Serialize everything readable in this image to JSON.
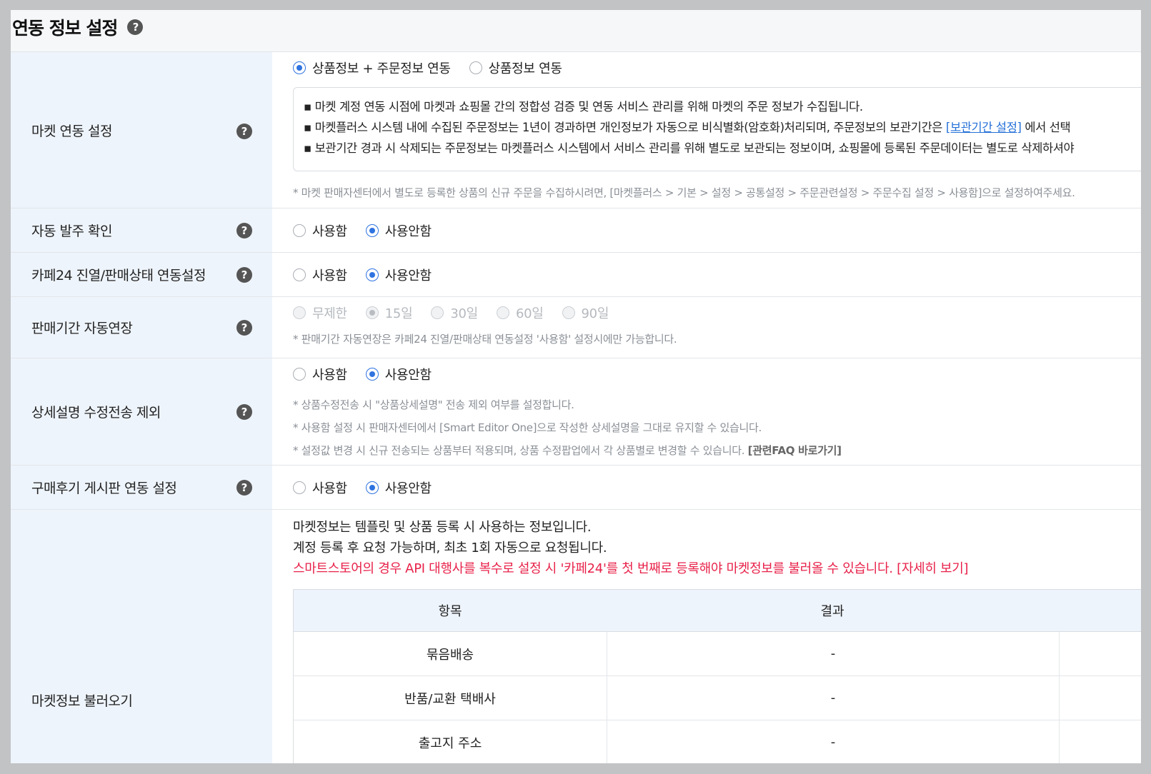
{
  "page": {
    "title": "연동 정보 설정",
    "help_glyph": "?"
  },
  "rows": [
    {
      "label": "마켓 연동 설정",
      "options": [
        {
          "label": "상품정보 + 주문정보 연동",
          "checked": true
        },
        {
          "label": "상품정보 연동",
          "checked": false
        }
      ],
      "notice": {
        "line1": "마켓 계정 연동 시점에 마켓과 쇼핑몰 간의 정합성 검증 및 연동 서비스 관리를 위해 마켓의 주문 정보가 수집됩니다.",
        "line2_pre": "마켓플러스 시스템 내에 수집된 주문정보는 1년이 경과하면 개인정보가 자동으로 비식별화(암호화)처리되며, 주문정보의 보관기간은 ",
        "line2_link": "[보관기간 설정]",
        "line2_post": " 에서 선택",
        "line3": "보관기간 경과 시 삭제되는 주문정보는 마켓플러스 시스템에서 서비스 관리를 위해 별도로 보관되는 정보이며, 쇼핑몰에 등록된 주문데이터는 별도로 삭제하셔야"
      },
      "note": "* 마켓 판매자센터에서 별도로 등록한 상품의 신규 주문을 수집하시려면, [마켓플러스 > 기본 > 설정 > 공통설정 > 주문관련설정 > 주문수집 설정 > 사용함]으로 설정하여주세요."
    },
    {
      "label": "자동 발주 확인",
      "options": [
        {
          "label": "사용함",
          "checked": false
        },
        {
          "label": "사용안함",
          "checked": true
        }
      ]
    },
    {
      "label": "카페24 진열/판매상태 연동설정",
      "options": [
        {
          "label": "사용함",
          "checked": false
        },
        {
          "label": "사용안함",
          "checked": true
        }
      ]
    },
    {
      "label": "판매기간 자동연장",
      "options": [
        {
          "label": "무제한",
          "checked": false
        },
        {
          "label": "15일",
          "checked": true
        },
        {
          "label": "30일",
          "checked": false
        },
        {
          "label": "60일",
          "checked": false
        },
        {
          "label": "90일",
          "checked": false
        }
      ],
      "note": "* 판매기간 자동연장은 카페24 진열/판매상태 연동설정 '사용함' 설정시에만 가능합니다."
    },
    {
      "label": "상세설명 수정전송 제외",
      "options": [
        {
          "label": "사용함",
          "checked": false
        },
        {
          "label": "사용안함",
          "checked": true
        }
      ],
      "notes": [
        "* 상품수정전송 시 \"상품상세설명\" 전송 제외 여부를 설정합니다.",
        "* 사용함 설정 시 판매자센터에서 [Smart Editor One]으로 작성한 상세설명을 그대로 유지할 수 있습니다.",
        "* 설정값 변경 시 신규 전송되는 상품부터 적용되며, 상품 수정팝업에서 각 상품별로 변경할 수 있습니다. "
      ],
      "faq_link": "[관련FAQ 바로가기]"
    },
    {
      "label": "구매후기 게시판 연동 설정",
      "options": [
        {
          "label": "사용함",
          "checked": false
        },
        {
          "label": "사용안함",
          "checked": true
        }
      ]
    },
    {
      "label": "마켓정보 불러오기",
      "info1": "마켓정보는 템플릿 및 상품 등록 시 사용하는 정보입니다.",
      "info2": "계정 등록 후 요청 가능하며, 최초 1회 자동으로 요청됩니다.",
      "info3": "스마트스토어의 경우 API 대행사를 복수로 설정 시 '카페24'를 첫 번째로 등록해야 마켓정보를 불러올 수 있습니다. [자세히 보기]",
      "table": {
        "headers": [
          "항목",
          "결과"
        ],
        "rows": [
          {
            "item": "묶음배송",
            "result": "-"
          },
          {
            "item": "반품/교환 택배사",
            "result": "-"
          },
          {
            "item": "출고지 주소",
            "result": "-"
          }
        ]
      }
    }
  ],
  "colors": {
    "accent": "#2f73e0",
    "label_bg": "#eef4fb",
    "link": "#2470d8",
    "warning": "#e8224a"
  }
}
